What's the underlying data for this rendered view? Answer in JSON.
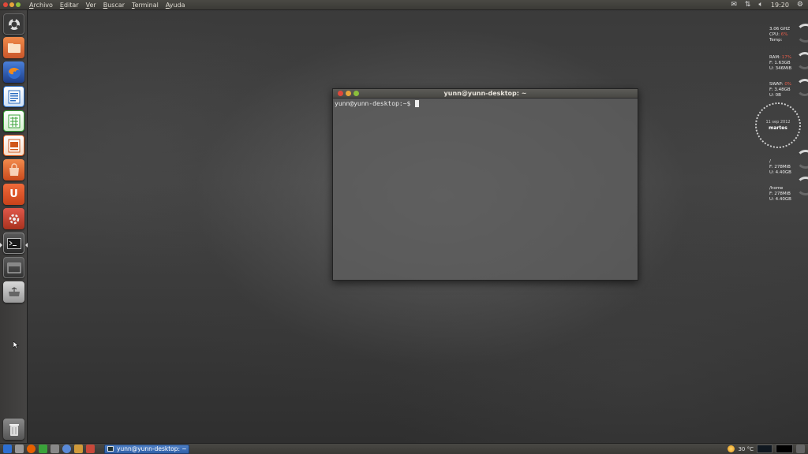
{
  "top_panel": {
    "menu": [
      "Archivo",
      "Editar",
      "Ver",
      "Buscar",
      "Terminal",
      "Ayuda"
    ],
    "tray_icons": [
      "mail-icon",
      "network-arrows-icon",
      "volume-icon"
    ],
    "clock": "19:20",
    "session_icon": "gear-icon"
  },
  "launcher": {
    "items": [
      {
        "name": "dash-home",
        "icon": "ubuntu-logo-icon"
      },
      {
        "name": "home-folder",
        "icon": "folder-icon",
        "color": "#e8763a"
      },
      {
        "name": "firefox",
        "icon": "firefox-icon",
        "color": "#e66000"
      },
      {
        "name": "libreoffice-writer",
        "icon": "writer-icon",
        "color": "#2a6cc0"
      },
      {
        "name": "libreoffice-calc",
        "icon": "calc-icon",
        "color": "#3aa33a"
      },
      {
        "name": "libreoffice-impress",
        "icon": "impress-icon",
        "color": "#d0581c"
      },
      {
        "name": "software-center",
        "icon": "shopping-bag-icon",
        "color": "#e06a2a"
      },
      {
        "name": "ubuntu-one",
        "icon": "ubuntu-one-icon",
        "letter": "U",
        "color": "#e2582a"
      },
      {
        "name": "system-settings",
        "icon": "settings-wrench-icon",
        "color": "#c8483a"
      },
      {
        "name": "terminal",
        "icon": "terminal-icon",
        "color": "#3a3a3a"
      },
      {
        "name": "workspace-switcher",
        "icon": "workspace-icon",
        "color": "#555"
      },
      {
        "name": "removable-drive",
        "icon": "usb-drive-icon",
        "color": "#8a8a8a"
      },
      {
        "name": "trash",
        "icon": "trash-icon",
        "color": "#777"
      }
    ]
  },
  "terminal": {
    "title": "yunn@yunn-desktop: ~",
    "prompt": "yunn@yunn-desktop:~$"
  },
  "conky": {
    "cpu": {
      "freq": "3.06 GHZ",
      "cpu_label": "CPU:",
      "cpu_value": "6%",
      "temp_label": "Temp:"
    },
    "ram": {
      "ram_label": "RAM:",
      "ram_value": "17%",
      "free": "F: 1.63GB",
      "used": "U: 346MiB"
    },
    "swap": {
      "swap_label": "SWAP:",
      "swap_value": "0%",
      "free": "F: 3.48GB",
      "used": "U: 0B"
    },
    "clock": {
      "date": "11 sep 2012",
      "day": "martes"
    },
    "fs_root": {
      "label": "/",
      "free": "F: 278MiB",
      "used": "U: 4.40GB"
    },
    "fs_home": {
      "label": "/home",
      "free": "F: 278MiB",
      "used": "U: 4.40GB"
    }
  },
  "bottom_panel": {
    "task_label": "yunn@yunn-desktop: ~",
    "weather": "30 °C"
  }
}
